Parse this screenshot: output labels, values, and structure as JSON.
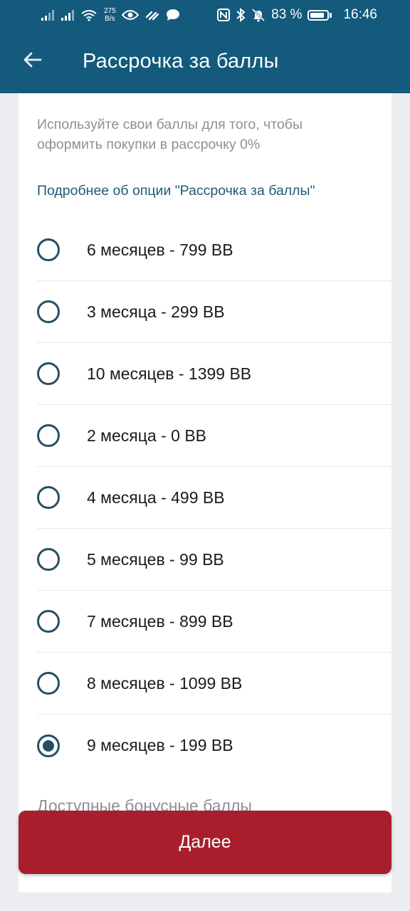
{
  "status_bar": {
    "net_speed_value": "275",
    "net_speed_unit": "B/s",
    "battery_percent": "83 %",
    "battery_level": 0.83,
    "time": "16:46",
    "icons": [
      "signal-icon",
      "signal-icon",
      "wifi-icon",
      "eye-icon",
      "huawei-share-icon",
      "chat-icon",
      "nfc-icon",
      "bluetooth-icon",
      "mute-icon",
      "battery-icon"
    ]
  },
  "app_bar": {
    "back_icon": "arrow-left-icon",
    "title": "Рассрочка за баллы"
  },
  "content": {
    "description": "Используйте свои баллы для того, чтобы оформить покупки в рассрочку 0%",
    "more_link": "Подробнее об опции \"Рассрочка за баллы\"",
    "options": [
      {
        "label": "6 месяцев - 799 BB",
        "selected": false
      },
      {
        "label": "3 месяца - 299 BB",
        "selected": false
      },
      {
        "label": "10 месяцев - 1399 BB",
        "selected": false
      },
      {
        "label": "2 месяца - 0 BB",
        "selected": false
      },
      {
        "label": "4 месяца - 499 BB",
        "selected": false
      },
      {
        "label": "5 месяцев - 99 BB",
        "selected": false
      },
      {
        "label": "7 месяцев - 899 BB",
        "selected": false
      },
      {
        "label": "8 месяцев - 1099 BB",
        "selected": false
      },
      {
        "label": "9 месяцев - 199 BB",
        "selected": true
      }
    ],
    "bonus_heading": "Доступные бонусные баллы"
  },
  "next_button": {
    "label": "Далее"
  },
  "colors": {
    "primary": "#135a7c",
    "accent": "#a91e2c",
    "radio": "#264f66",
    "link": "#205a77"
  }
}
